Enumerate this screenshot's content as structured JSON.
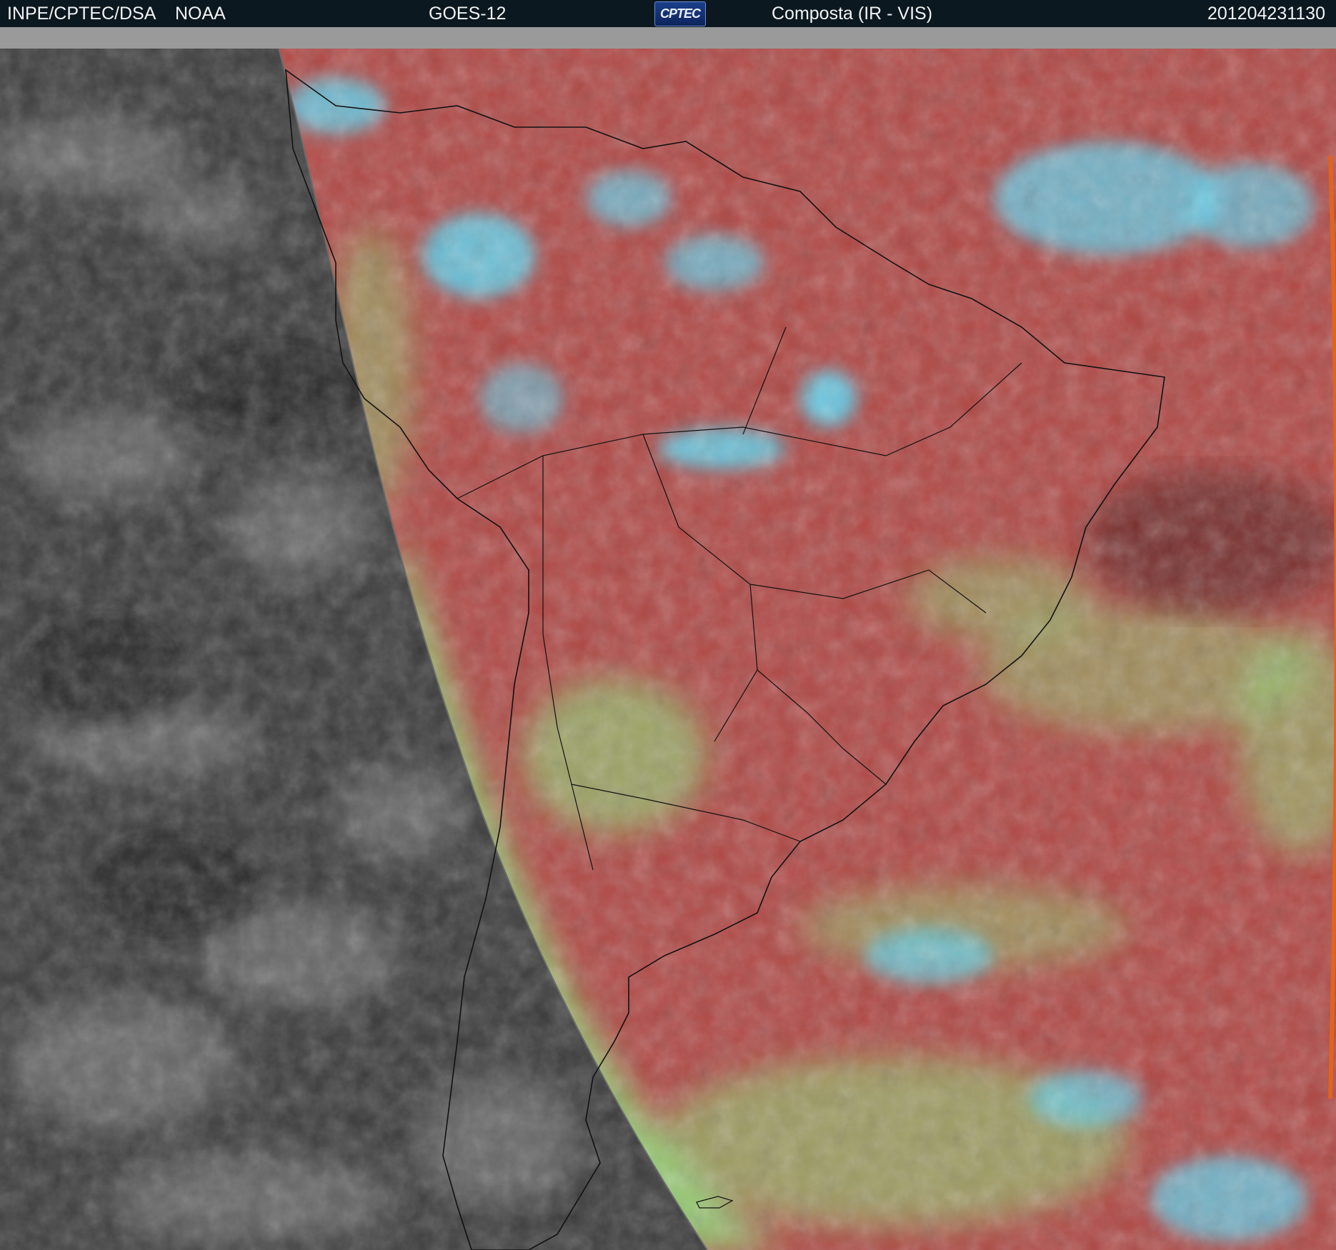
{
  "header": {
    "agency": "INPE/CPTEC/DSA",
    "provider": "NOAA",
    "satellite": "GOES-12",
    "logo_text": "CPTEC",
    "product": "Composta (IR - VIS)",
    "timestamp": "201204231130"
  },
  "colors": {
    "night_side": "#3c3c3c",
    "day_land_and_clear": "#b04845",
    "high_cloud": "#5fd3ef",
    "low_cloud": "#8fe07a",
    "coastline": "#111111",
    "space_band": "#9a9a9a"
  }
}
